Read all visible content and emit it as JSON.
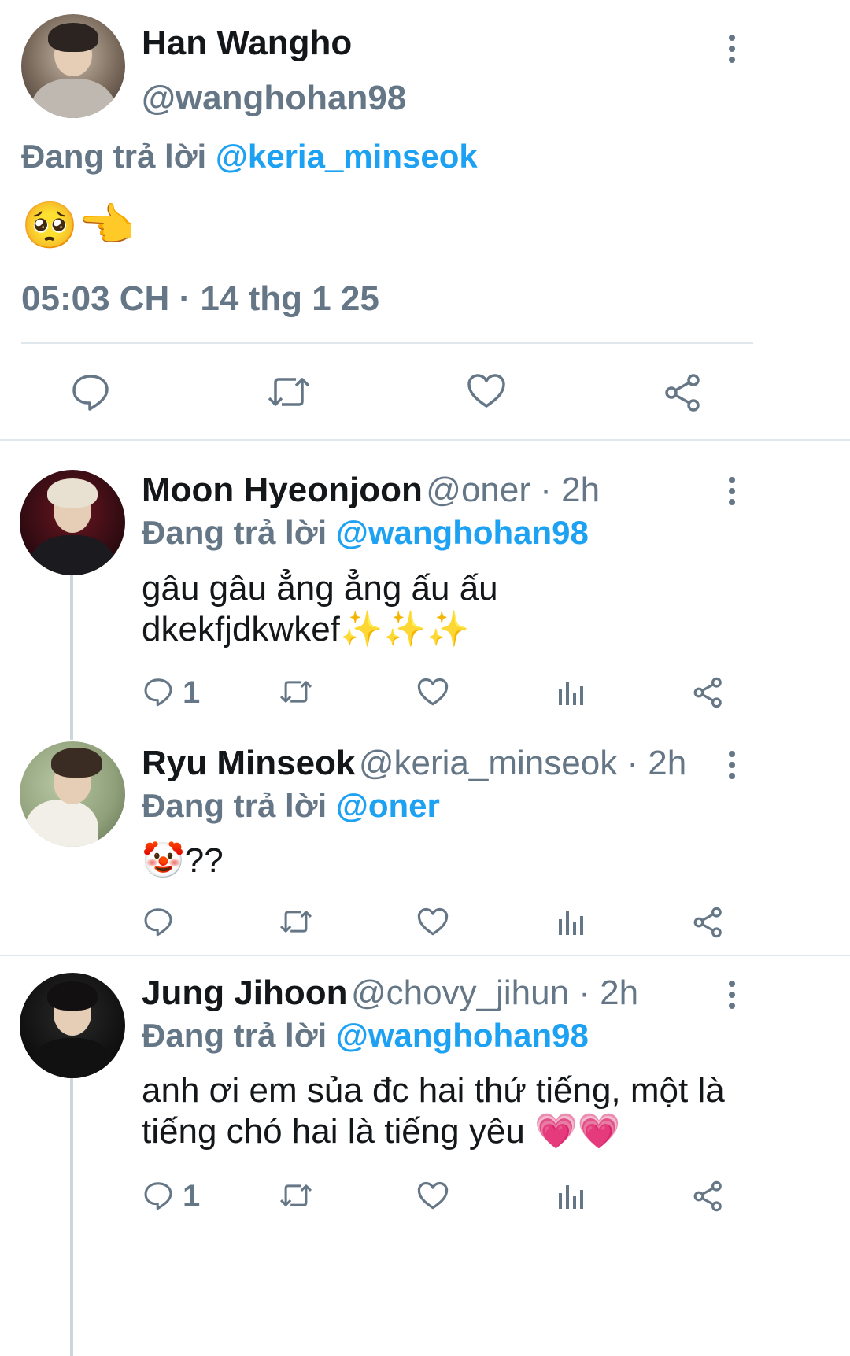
{
  "main_tweet": {
    "name": "Han Wangho",
    "handle": "@wanghohan98",
    "reply_prefix": "Đang trả lời ",
    "reply_to": "@keria_minseok",
    "content": "🥺👈",
    "timestamp": "05:03 CH · 14 thg 1 25"
  },
  "replies": [
    {
      "name": "Moon Hyeonjoon",
      "meta": "@oner · 2h",
      "reply_prefix": "Đang trả lời ",
      "reply_to": "@wanghohan98",
      "content": "gâu gâu ẳng ẳng ấu ấu dkekfjdkwkef✨✨✨",
      "reply_count": "1"
    },
    {
      "name": "Ryu Minseok",
      "meta": "@keria_minseok · 2h",
      "reply_prefix": "Đang trả lời ",
      "reply_to": "@oner",
      "content": "🤡??",
      "reply_count": ""
    },
    {
      "name": "Jung Jihoon",
      "meta": "@chovy_jihun · 2h",
      "reply_prefix": "Đang trả lời ",
      "reply_to": "@wanghohan98",
      "content": "anh ơi em sủa đc hai thứ tiếng, một là tiếng chó hai là tiếng yêu 💗💗",
      "reply_count": "1"
    }
  ],
  "icons": {
    "reply": "reply-icon",
    "retweet": "retweet-icon",
    "like": "heart-icon",
    "analytics": "analytics-icon",
    "share": "share-icon",
    "more": "more-vertical-icon"
  },
  "colors": {
    "accent": "#1da1f2",
    "secondary_text": "#657786",
    "divider": "#e1e8ed"
  }
}
